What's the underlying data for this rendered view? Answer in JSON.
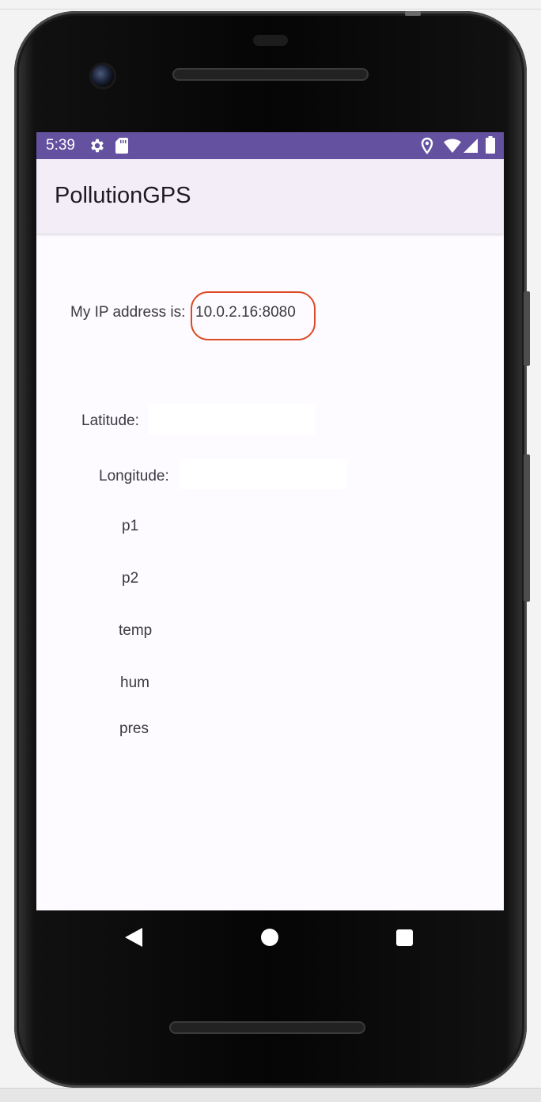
{
  "status_bar": {
    "time": "5:39",
    "left_icons": [
      "gear-icon",
      "sd-card-icon"
    ],
    "right_icons": [
      "location-icon",
      "wifi-icon",
      "cell-signal-icon",
      "battery-icon"
    ],
    "background_color": "#6452a0"
  },
  "app_bar": {
    "title": "PollutionGPS",
    "background_color": "#f2edf7"
  },
  "content": {
    "ip_label": "My IP address is:",
    "ip_value": "10.0.2.16:8080",
    "annotation_color": "#dc4a22",
    "latitude_label": "Latitude:",
    "latitude_value": "",
    "longitude_label": "Longitude:",
    "longitude_value": "",
    "readings": {
      "p1": "p1",
      "p2": "p2",
      "temp": "temp",
      "hum": "hum",
      "pres": "pres"
    }
  },
  "nav_bar": {
    "buttons": [
      "back-icon",
      "home-icon",
      "recents-icon"
    ]
  }
}
